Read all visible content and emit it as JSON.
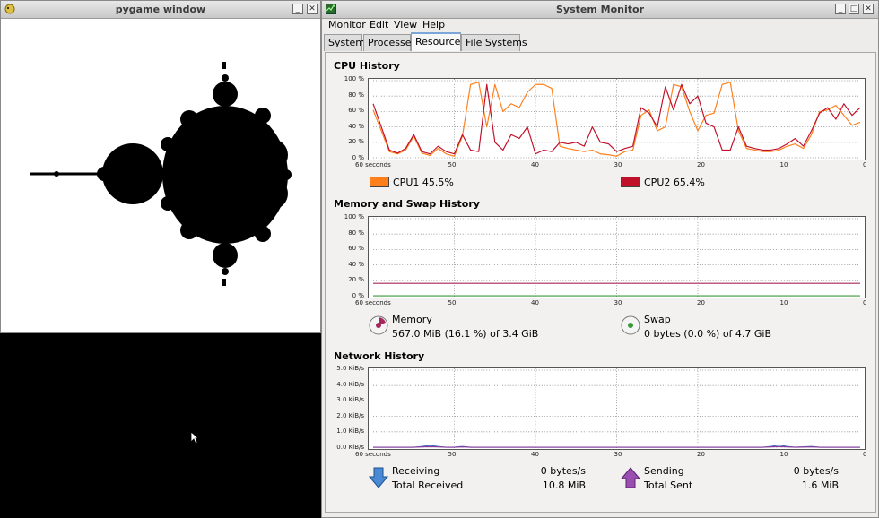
{
  "pygame": {
    "title": "pygame window"
  },
  "sysmon": {
    "title": "System Monitor",
    "menu": [
      "Monitor",
      "Edit",
      "View",
      "Help"
    ],
    "tabs": [
      "System",
      "Processes",
      "Resources",
      "File Systems"
    ],
    "active_tab": 2,
    "cpu": {
      "section_title": "CPU History",
      "y_ticks": [
        "100 %",
        "80 %",
        "60 %",
        "40 %",
        "20 %",
        "0 %"
      ],
      "x_ticks": [
        "60 seconds",
        "50",
        "40",
        "30",
        "20",
        "10",
        "0"
      ],
      "cpu1_label": "CPU1 45.5%",
      "cpu2_label": "CPU2 65.4%",
      "cpu1_color": "#ff7f1a",
      "cpu2_color": "#c0102a"
    },
    "memory": {
      "section_title": "Memory and Swap History",
      "y_ticks": [
        "100 %",
        "80 %",
        "60 %",
        "40 %",
        "20 %",
        "0 %"
      ],
      "x_ticks": [
        "60 seconds",
        "50",
        "40",
        "30",
        "20",
        "10",
        "0"
      ],
      "memory_label": "Memory",
      "memory_value": "567.0 MiB (16.1 %) of 3.4 GiB",
      "swap_label": "Swap",
      "swap_value": "0 bytes (0.0 %) of 4.7 GiB",
      "memory_color": "#a4285c",
      "swap_color": "#3a9a3a"
    },
    "network": {
      "section_title": "Network History",
      "y_ticks": [
        "5.0 KiB/s",
        "4.0 KiB/s",
        "3.0 KiB/s",
        "2.0 KiB/s",
        "1.0 KiB/s",
        "0.0 KiB/s"
      ],
      "x_ticks": [
        "60 seconds",
        "50",
        "40",
        "30",
        "20",
        "10",
        "0"
      ],
      "receiving_label": "Receiving",
      "receiving_value": "0 bytes/s",
      "total_received_label": "Total Received",
      "total_received_value": "10.8 MiB",
      "sending_label": "Sending",
      "sending_value": "0 bytes/s",
      "total_sent_label": "Total Sent",
      "total_sent_value": "1.6 MiB",
      "receiving_color": "#3b6fc4",
      "sending_color": "#8b3b9b"
    }
  },
  "chart_data": [
    {
      "type": "line",
      "title": "CPU History",
      "xlabel": "",
      "ylabel": "",
      "x": [
        60,
        59,
        58,
        57,
        56,
        55,
        54,
        53,
        52,
        51,
        50,
        49,
        48,
        47,
        46,
        45,
        44,
        43,
        42,
        41,
        40,
        39,
        38,
        37,
        36,
        35,
        34,
        33,
        32,
        31,
        30,
        29,
        28,
        27,
        26,
        25,
        24,
        23,
        22,
        21,
        20,
        19,
        18,
        17,
        16,
        15,
        14,
        13,
        12,
        11,
        10,
        9,
        8,
        7,
        6,
        5,
        4,
        3,
        2,
        1,
        0
      ],
      "xlim": [
        60,
        0
      ],
      "ylim": [
        0,
        100
      ],
      "grid": true,
      "series": [
        {
          "name": "CPU1 45.5%",
          "values": [
            62,
            35,
            8,
            5,
            10,
            28,
            6,
            3,
            12,
            5,
            2,
            28,
            95,
            98,
            40,
            95,
            60,
            70,
            65,
            85,
            95,
            95,
            90,
            15,
            12,
            10,
            8,
            10,
            5,
            4,
            2,
            8,
            10,
            55,
            62,
            35,
            40,
            95,
            92,
            60,
            35,
            55,
            58,
            95,
            98,
            35,
            12,
            10,
            8,
            8,
            10,
            15,
            18,
            12,
            30,
            60,
            62,
            68,
            55,
            42,
            46
          ]
        },
        {
          "name": "CPU2 65.4%",
          "values": [
            70,
            40,
            10,
            6,
            12,
            30,
            8,
            5,
            15,
            8,
            5,
            30,
            10,
            8,
            95,
            20,
            10,
            30,
            25,
            40,
            5,
            10,
            8,
            20,
            18,
            20,
            15,
            40,
            20,
            18,
            8,
            12,
            15,
            65,
            58,
            40,
            92,
            62,
            95,
            70,
            80,
            45,
            40,
            10,
            10,
            40,
            15,
            12,
            10,
            10,
            12,
            18,
            25,
            15,
            35,
            58,
            65,
            50,
            70,
            55,
            65
          ]
        }
      ]
    },
    {
      "type": "line",
      "title": "Memory and Swap History",
      "xlabel": "",
      "ylabel": "",
      "x": [
        60,
        0
      ],
      "xlim": [
        60,
        0
      ],
      "ylim": [
        0,
        100
      ],
      "grid": true,
      "series": [
        {
          "name": "Memory",
          "values": [
            16.1,
            16.1
          ]
        },
        {
          "name": "Swap",
          "values": [
            0,
            0
          ]
        }
      ]
    },
    {
      "type": "line",
      "title": "Network History",
      "xlabel": "",
      "ylabel": "",
      "x": [
        60,
        55,
        54,
        53,
        52,
        51,
        50,
        49,
        48,
        47,
        40,
        30,
        20,
        12,
        11,
        10,
        9,
        8,
        6,
        5,
        4,
        0
      ],
      "xlim": [
        60,
        0
      ],
      "ylim": [
        0,
        5
      ],
      "grid": true,
      "series": [
        {
          "name": "Receiving",
          "values": [
            0,
            0,
            0.05,
            0.12,
            0.05,
            0,
            0,
            0.05,
            0,
            0,
            0,
            0,
            0,
            0,
            0.05,
            0.15,
            0.05,
            0,
            0.05,
            0,
            0,
            0
          ]
        },
        {
          "name": "Sending",
          "values": [
            0,
            0,
            0.02,
            0.04,
            0.02,
            0,
            0,
            0.02,
            0,
            0,
            0,
            0,
            0,
            0,
            0.02,
            0.04,
            0.02,
            0,
            0.02,
            0,
            0,
            0
          ]
        }
      ]
    }
  ]
}
